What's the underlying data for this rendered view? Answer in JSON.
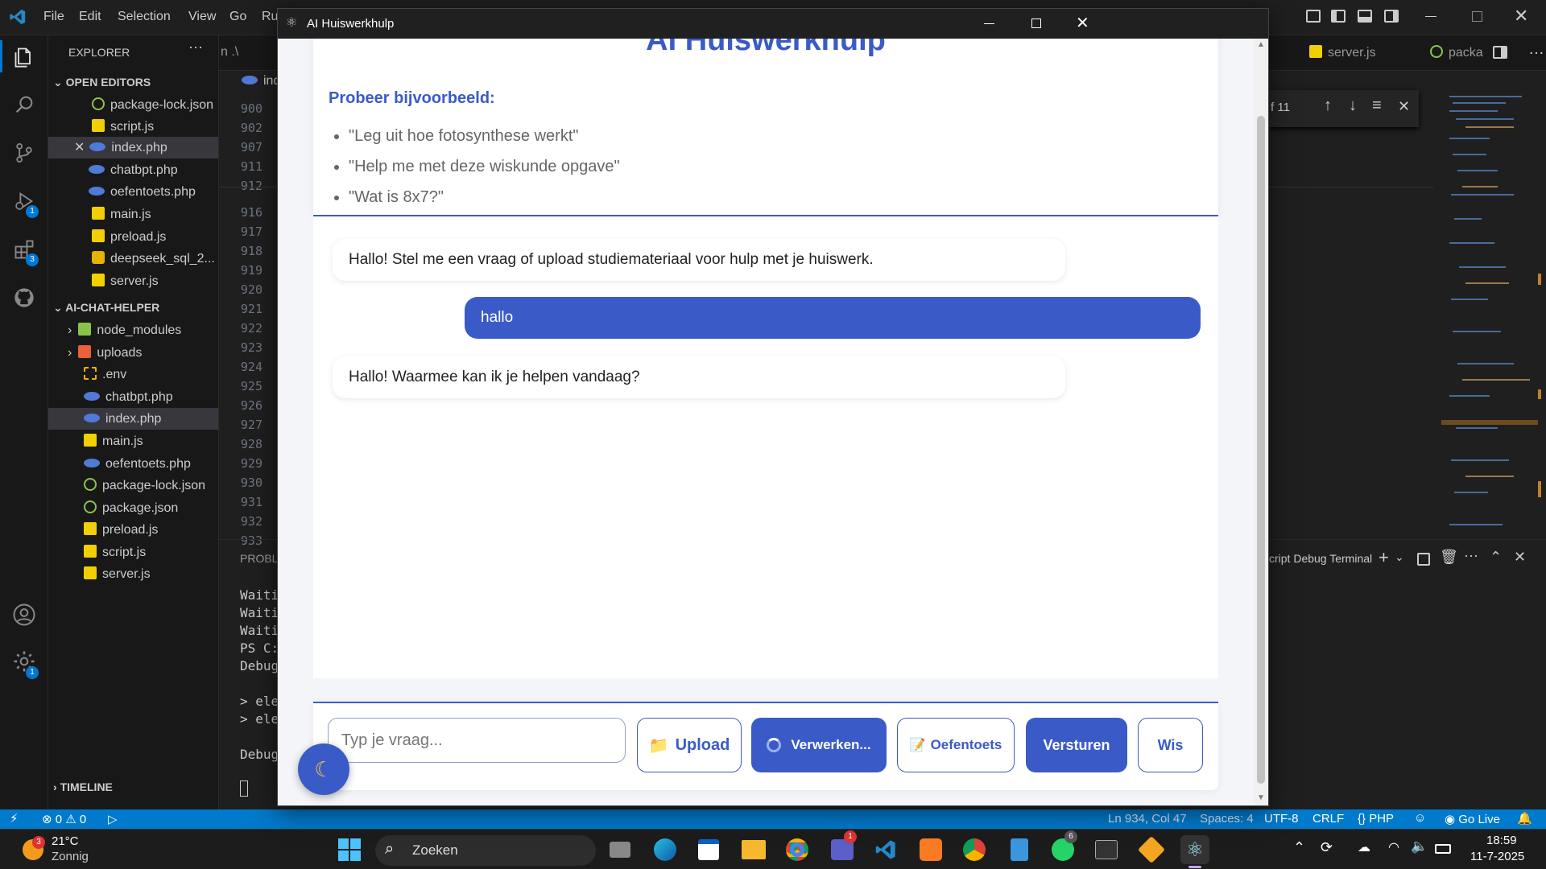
{
  "vscode": {
    "menu": [
      "File",
      "Edit",
      "Selection",
      "View",
      "Go",
      "Ru"
    ],
    "explorer_title": "EXPLORER",
    "open_editors_title": "OPEN EDITORS",
    "open_editors": [
      "package-lock.json",
      "script.js",
      "index.php",
      "chatbpt.php",
      "oefentoets.php",
      "main.js",
      "preload.js",
      "deepseek_sql_2...",
      "server.js"
    ],
    "project_title": "AI-CHAT-HELPER",
    "project_files": [
      "node_modules",
      "uploads",
      ".env",
      "chatbpt.php",
      "index.php",
      "main.js",
      "oefentoets.php",
      "package-lock.json",
      "package.json",
      "preload.js",
      "script.js",
      "server.js"
    ],
    "timeline_title": "TIMELINE",
    "tab_partial_left": "n .\\",
    "tab_ind": "ind",
    "tab_server": "server.js",
    "tab_packa": "packa",
    "line_numbers": [
      "900",
      "902",
      "907",
      "911",
      "912",
      "916",
      "917",
      "918",
      "919",
      "920",
      "921",
      "922",
      "923",
      "924",
      "925",
      "926",
      "927",
      "928",
      "929",
      "930",
      "931",
      "932",
      "933"
    ],
    "find_count": "f 11",
    "panel_title": "PROBLE",
    "terminal_lines": [
      "Waiti",
      "Waiti",
      "Waiti",
      "PS C:",
      "Debug",
      "",
      "> ele",
      "> ele",
      "",
      "Debug"
    ],
    "terminal_label": "cript Debug Terminal",
    "badges": {
      "run": "1",
      "extensions": "3",
      "settings": "1"
    }
  },
  "status": {
    "errors": "0",
    "warnings": "0",
    "position": "Ln 934, Col 47",
    "spaces": "Spaces: 4",
    "encoding": "UTF-8",
    "eol": "CRLF",
    "language": "PHP",
    "golive": "Go Live"
  },
  "app": {
    "window_title": "AI Huiswerkhulp",
    "heading": "AI Huiswerkhulp",
    "examples_title": "Probeer bijvoorbeeld:",
    "examples": [
      "\"Leg uit hoe fotosynthese werkt\"",
      "\"Help me met deze wiskunde opgave\"",
      "\"Wat is 8x7?\""
    ],
    "messages": [
      {
        "role": "bot",
        "text": "Hallo! Stel me een vraag of upload studiemateriaal voor hulp met je huiswerk."
      },
      {
        "role": "user",
        "text": "hallo"
      },
      {
        "role": "bot",
        "text": "Hallo! Waarmee kan ik je helpen vandaag?"
      }
    ],
    "input_placeholder": "Typ je vraag...",
    "upload_label": "Upload",
    "processing_label": "Verwerken...",
    "quiz_label": "Oefentoets",
    "send_label": "Versturen",
    "clear_label": "Wis",
    "accent_color": "#3a5bc7"
  },
  "taskbar": {
    "weather_temp": "21°C",
    "weather_desc": "Zonnig",
    "weather_badge": "3",
    "search_label": "Zoeken",
    "teams_badge": "1",
    "whatsapp_badge": "6",
    "time": "18:59",
    "date": "11-7-2025"
  }
}
